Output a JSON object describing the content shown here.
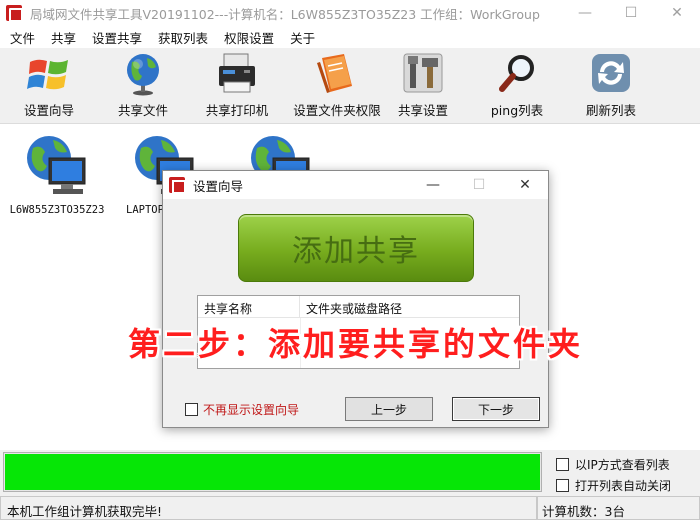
{
  "window": {
    "title": "局域网文件共享工具V20191102---计算机名：L6W855Z3TO35Z23  工作组：WorkGroup",
    "controls": {
      "minimize": "—",
      "maximize": "☐",
      "close": "✕"
    }
  },
  "menu": [
    "文件",
    "共享",
    "设置共享",
    "获取列表",
    "权限设置",
    "关于"
  ],
  "toolbar": [
    {
      "label": "设置向导",
      "icon": "windows-logo-icon"
    },
    {
      "label": "共享文件",
      "icon": "globe-icon"
    },
    {
      "label": "共享打印机",
      "icon": "printer-icon"
    },
    {
      "label": "设置文件夹权限",
      "icon": "folder-book-icon"
    },
    {
      "label": "共享设置",
      "icon": "tools-icon"
    },
    {
      "label": "ping列表",
      "icon": "magnifier-icon"
    },
    {
      "label": "刷新列表",
      "icon": "refresh-icon"
    }
  ],
  "computers": [
    {
      "name": "L6W855Z3TO35Z23"
    },
    {
      "name": "LAPTOP"
    },
    {
      "name": ""
    }
  ],
  "dialog": {
    "title": "设置向导",
    "controls": {
      "minimize": "—",
      "maximize": "☐",
      "close": "✕"
    },
    "add_share_label": "添加共享",
    "table_headers": [
      "共享名称",
      "文件夹或磁盘路径"
    ],
    "no_show_label": "不再显示设置向导",
    "prev_label": "上一步",
    "next_label": "下一步"
  },
  "annotation": "第二步：添加要共享的文件夹",
  "bottom": {
    "progress": 1.0,
    "option_ip_view": "以IP方式查看列表",
    "option_auto_close": "打开列表自动关闭",
    "status_text": "本机工作组计算机获取完毕!",
    "computer_count": "计算机数：3台"
  },
  "colors": {
    "progress": "#06e606",
    "add_share_green": "#77ac1e",
    "annotation_red": "#ff1e1e"
  }
}
